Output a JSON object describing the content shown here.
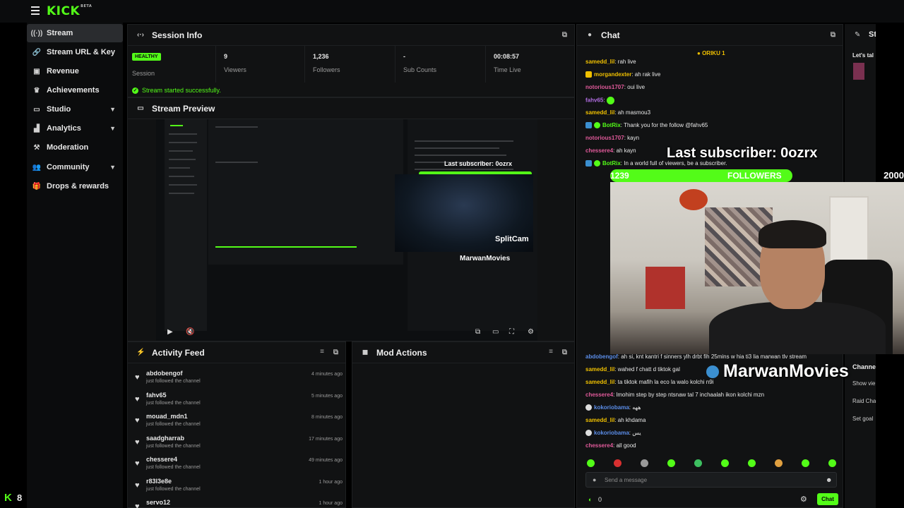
{
  "app": {
    "logo": "KICK",
    "logo_sup": "BETA"
  },
  "sidebar": {
    "items": [
      {
        "label": "Stream",
        "icon": "broadcast-icon"
      },
      {
        "label": "Stream URL & Key",
        "icon": "link-icon"
      },
      {
        "label": "Revenue",
        "icon": "wallet-icon"
      },
      {
        "label": "Achievements",
        "icon": "trophy-icon"
      },
      {
        "label": "Studio",
        "icon": "monitor-icon"
      },
      {
        "label": "Analytics",
        "icon": "chart-icon"
      },
      {
        "label": "Moderation",
        "icon": "gavel-icon"
      },
      {
        "label": "Community",
        "icon": "people-icon"
      },
      {
        "label": "Drops & rewards",
        "icon": "gift-icon"
      }
    ],
    "bottom_count": "8"
  },
  "session": {
    "title": "Session Info",
    "health": "HEALTHY",
    "health_label": "Session",
    "viewers": "9",
    "viewers_label": "Viewers",
    "followers": "1,236",
    "followers_label": "Followers",
    "sub_counts": "-",
    "sub_counts_label": "Sub Counts",
    "time_live": "00:08:57",
    "time_live_label": "Time Live",
    "success": "Stream started successfully."
  },
  "preview": {
    "title": "Stream Preview",
    "mini_sub": "Last subscriber: 0ozrx",
    "mini_splitcam": "SplitCam",
    "mini_name": "MarwanMovies"
  },
  "activity": {
    "title": "Activity Feed",
    "rows": [
      {
        "name": "abdobengof",
        "sub": "just followed the channel",
        "time": "4 minutes ago"
      },
      {
        "name": "fahv65",
        "sub": "just followed the channel",
        "time": "5 minutes ago"
      },
      {
        "name": "mouad_mdn1",
        "sub": "just followed the channel",
        "time": "8 minutes ago"
      },
      {
        "name": "saadgharrab",
        "sub": "just followed the channel",
        "time": "17 minutes ago"
      },
      {
        "name": "chessere4",
        "sub": "just followed the channel",
        "time": "49 minutes ago"
      },
      {
        "name": "r83l3e8e",
        "sub": "just followed the channel",
        "time": "1 hour ago"
      },
      {
        "name": "servo12",
        "sub": "",
        "time": "1 hour ago"
      }
    ]
  },
  "mod": {
    "title": "Mod Actions"
  },
  "chat": {
    "title": "Chat",
    "pinned": "ORIKU 1",
    "messages": [
      {
        "user": "samedd_lil",
        "color": "#f0c000",
        "text": ": rah live"
      },
      {
        "user": "morgandexter",
        "color": "#f0c000",
        "text": ": ah rak live"
      },
      {
        "user": "notorious1707",
        "color": "#e05a9a",
        "text": ": oui live"
      },
      {
        "user": "fahv65",
        "color": "#b06de0",
        "text": ":"
      },
      {
        "user": "samedd_lil",
        "color": "#f0c000",
        "text": ": ah masmou3"
      },
      {
        "user": "BotRix",
        "color": "#53fc18",
        "text": ": Thank you for the follow @fahv65"
      },
      {
        "user": "notorious1707",
        "color": "#e05a9a",
        "text": ": kayn"
      },
      {
        "user": "chessere4",
        "color": "#e05a9a",
        "text": ": ah kayn"
      },
      {
        "user": "BotRix",
        "color": "#53fc18",
        "text": ": In a world full of viewers, be a subscriber."
      },
      {
        "user": "abdobengof",
        "color": "#5b8de8",
        "text": ": ah si, knt kantri f sinners ylh drbt fih 25mins w hia ti3 lia marwan tlv stream"
      },
      {
        "user": "samedd_lil",
        "color": "#f0c000",
        "text": ": wahed f chatt d tiktok gal"
      },
      {
        "user": "samedd_lil",
        "color": "#f0c000",
        "text": ": ta tiktok mafih la eco la walo kolchi n9i"
      },
      {
        "user": "chessere4",
        "color": "#e05a9a",
        "text": ": lmohim step by step ntsnaw tal 7 inchaalah ikon kolchi mzn"
      },
      {
        "user": "kokoriobama",
        "color": "#5b8de8",
        "text": ": ههه"
      },
      {
        "user": "samedd_lil",
        "color": "#f0c000",
        "text": ": ah khdama"
      },
      {
        "user": "kokoriobama",
        "color": "#5b8de8",
        "text": ": يس"
      },
      {
        "user": "chessere4",
        "color": "#e05a9a",
        "text": ": all good"
      }
    ],
    "input_placeholder": "Send a message",
    "send_label": "Chat",
    "points": "0"
  },
  "rightpanel": {
    "title": "St",
    "text1": "Let's tal",
    "text2": "Channe",
    "text3": "Show vie",
    "text4": "Raid Cha",
    "text5": "Set goal"
  },
  "overlay": {
    "last_sub": "Last subscriber: 0ozrx",
    "goal_current": "1239",
    "goal_label": "FOLLOWERS",
    "goal_target": "2000",
    "goal_progress": 0.62,
    "channel_name": "MarwanMovies"
  }
}
